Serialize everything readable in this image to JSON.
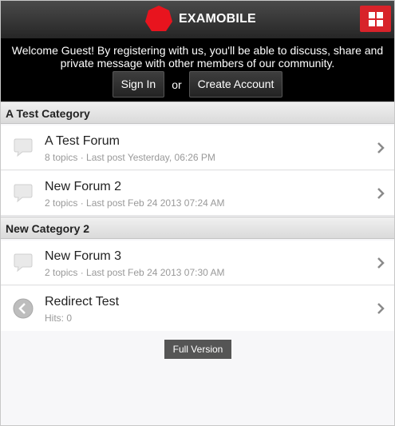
{
  "header": {
    "brand": "EXAMOBILE",
    "colors": {
      "logo": "#e8141e",
      "menu": "#d8232a"
    }
  },
  "welcome": {
    "message": "Welcome Guest! By registering with us, you'll be able to discuss, share and private message with other members of our community.",
    "sign_in": "Sign In",
    "or": "or",
    "create_account": "Create Account"
  },
  "categories": [
    {
      "name": "A Test Category",
      "forums": [
        {
          "title": "A Test Forum",
          "meta": "8 topics · Last post Yesterday, 06:26 PM",
          "icon": "speech-bubble-icon"
        },
        {
          "title": "New Forum 2",
          "meta": "2 topics · Last post Feb 24 2013 07:24 AM",
          "icon": "speech-bubble-icon"
        }
      ]
    },
    {
      "name": "New Category 2",
      "forums": [
        {
          "title": "New Forum 3",
          "meta": "2 topics · Last post Feb 24 2013 07:30 AM",
          "icon": "speech-bubble-icon"
        },
        {
          "title": "Redirect Test",
          "meta": "Hits: 0",
          "icon": "redirect-arrow-icon"
        }
      ]
    }
  ],
  "footer": {
    "full_version": "Full Version"
  }
}
